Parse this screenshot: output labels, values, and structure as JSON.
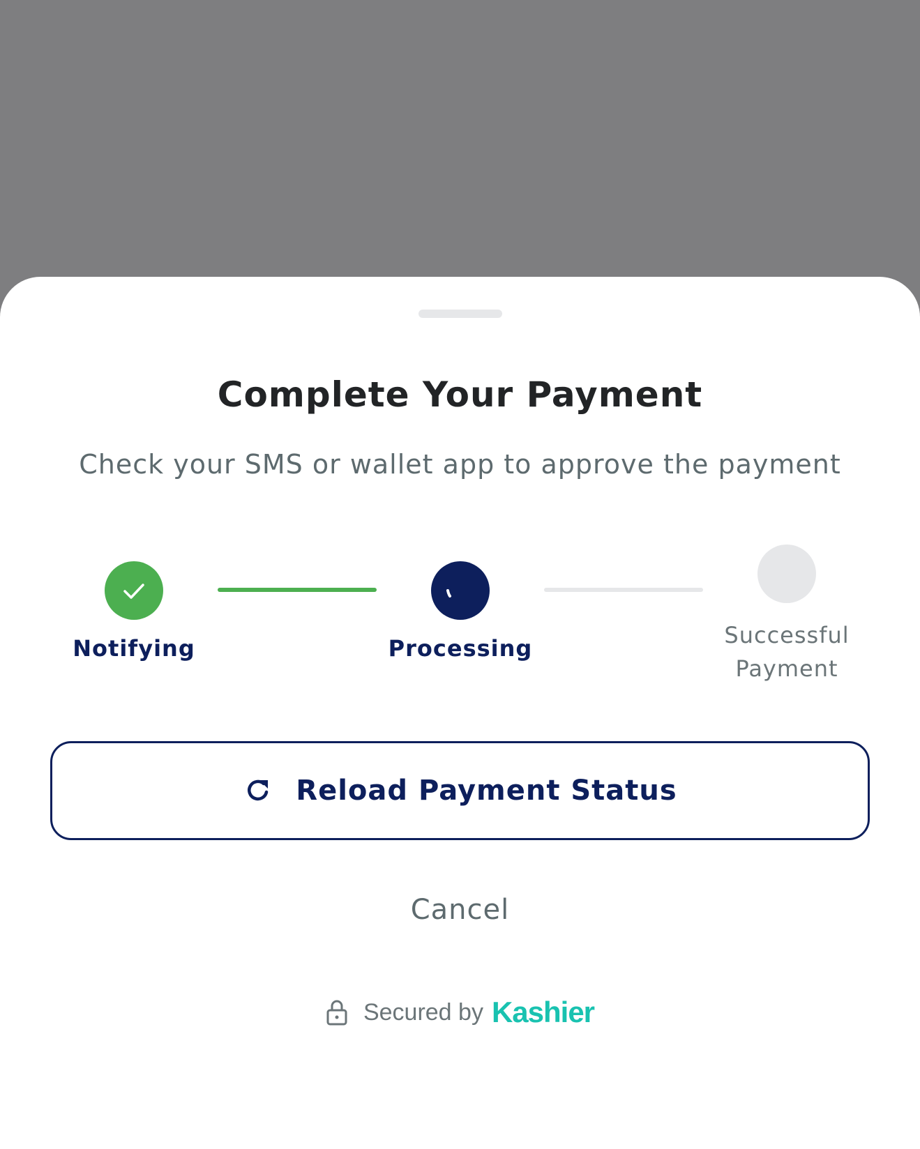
{
  "sheet": {
    "title": "Complete Your Payment",
    "subtitle": "Check your SMS or wallet app to approve the payment"
  },
  "stepper": {
    "steps": [
      {
        "label": "Notifying",
        "status": "completed",
        "icon": "check-icon"
      },
      {
        "label": "Processing",
        "status": "active",
        "icon": "spinner-icon"
      },
      {
        "label_line1": "Successful",
        "label_line2": "Payment",
        "status": "pending"
      }
    ]
  },
  "actions": {
    "reload_label": "Reload Payment Status",
    "reload_icon": "refresh-icon",
    "cancel_label": "Cancel"
  },
  "footer": {
    "secured_text": "Secured by",
    "brand": "Kashier",
    "lock_icon": "lock-icon"
  },
  "colors": {
    "primary": "#0d1f5c",
    "success": "#4caf50",
    "pending": "#e6e7e9",
    "brand": "#19c2b0",
    "overlay": "#7e7e80"
  }
}
